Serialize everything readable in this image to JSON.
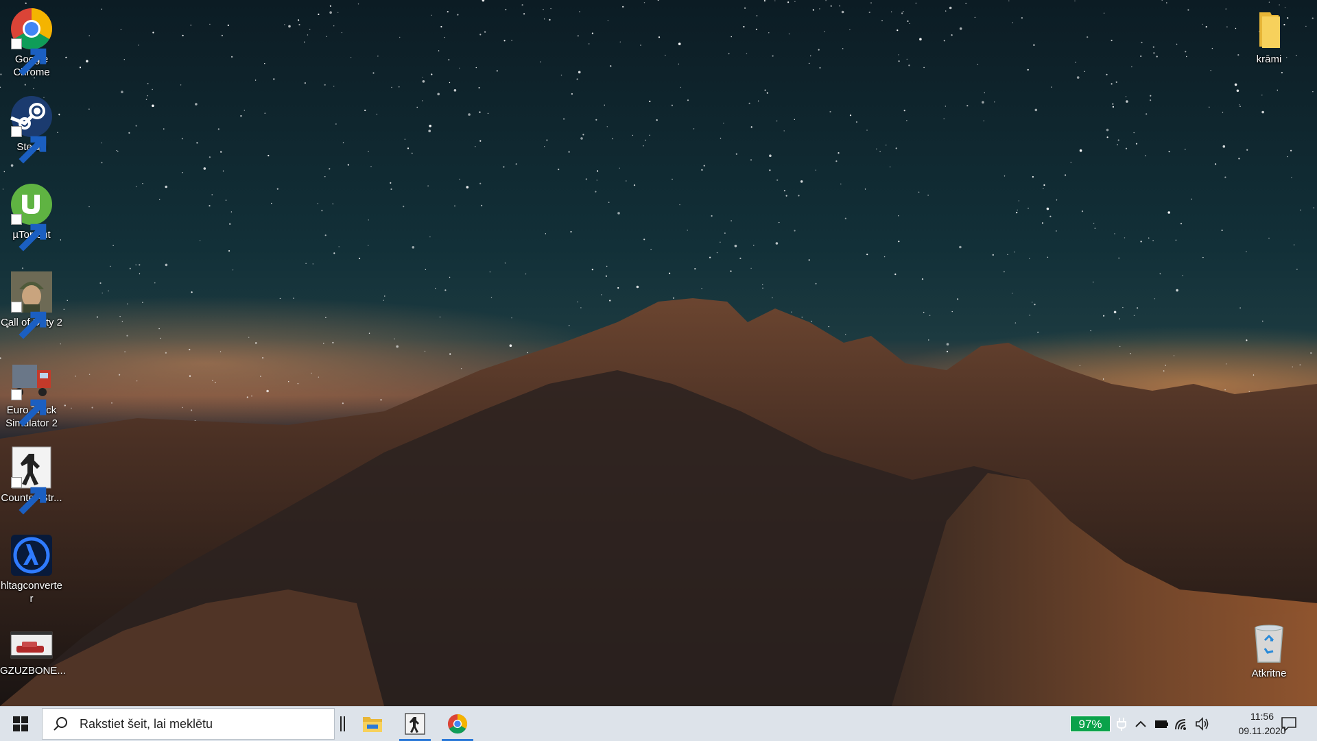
{
  "desktop": {
    "icons_left": [
      {
        "id": "chrome",
        "label": "Google Chrome",
        "icon": "chrome-icon"
      },
      {
        "id": "steam",
        "label": "Steam",
        "icon": "steam-icon"
      },
      {
        "id": "utorrent",
        "label": "µTorrent",
        "icon": "utorrent-icon"
      },
      {
        "id": "cod2",
        "label": "Call of Duty 2",
        "icon": "call-of-duty-2-icon"
      },
      {
        "id": "ets2",
        "label": "Euro Truck Simulator 2",
        "icon": "euro-truck-icon"
      },
      {
        "id": "cs",
        "label": "Counter-Str...",
        "icon": "counter-strike-icon"
      },
      {
        "id": "hltag",
        "label": "hltagconverter",
        "icon": "half-life-icon"
      },
      {
        "id": "gzuz",
        "label": "GZUZBONE...",
        "icon": "video-thumbnail-icon"
      }
    ],
    "icons_right": [
      {
        "id": "krami",
        "label": "krāmi",
        "icon": "folder-icon"
      },
      {
        "id": "recycle",
        "label": "Atkritne",
        "icon": "recycle-bin-icon"
      }
    ]
  },
  "taskbar": {
    "search_placeholder": "Rakstiet šeit, lai meklētu",
    "pinned": [
      {
        "id": "explorer",
        "icon": "file-explorer-icon",
        "active": false
      },
      {
        "id": "cs",
        "icon": "counter-strike-icon",
        "active": true
      },
      {
        "id": "chrome",
        "icon": "chrome-icon",
        "active": true
      }
    ],
    "battery_percent": "97%",
    "time": "11:56",
    "date": "09.11.2020",
    "colors": {
      "battery_badge": "#0aa24a",
      "active_indicator": "#2b79d8"
    }
  }
}
